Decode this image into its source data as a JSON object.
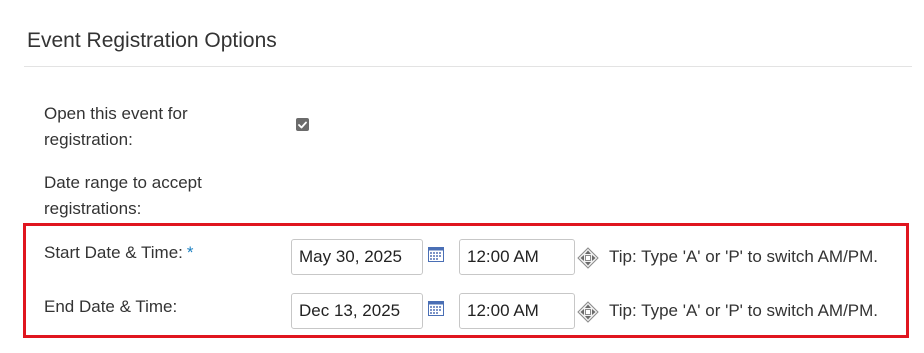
{
  "section": {
    "title": "Event Registration Options"
  },
  "open_registration": {
    "label": "Open this event for registration:",
    "checked": true
  },
  "date_range": {
    "label": "Date range to accept registrations:"
  },
  "start": {
    "label": "Start Date & Time:",
    "required_marker": "*",
    "date": "May 30, 2025",
    "time": "12:00 AM",
    "tip": "Tip: Type 'A' or 'P' to switch AM/PM."
  },
  "end": {
    "label": "End Date & Time:",
    "date": "Dec 13, 2025",
    "time": "12:00 AM",
    "tip": "Tip: Type 'A' or 'P' to switch AM/PM."
  },
  "colors": {
    "highlight": "#e0151f",
    "required": "#1a7fc1",
    "calendar_icon": "#4a6fb5"
  },
  "icons": {
    "calendar": "calendar-icon",
    "spinner": "time-spinner-icon",
    "check": "check-icon"
  }
}
